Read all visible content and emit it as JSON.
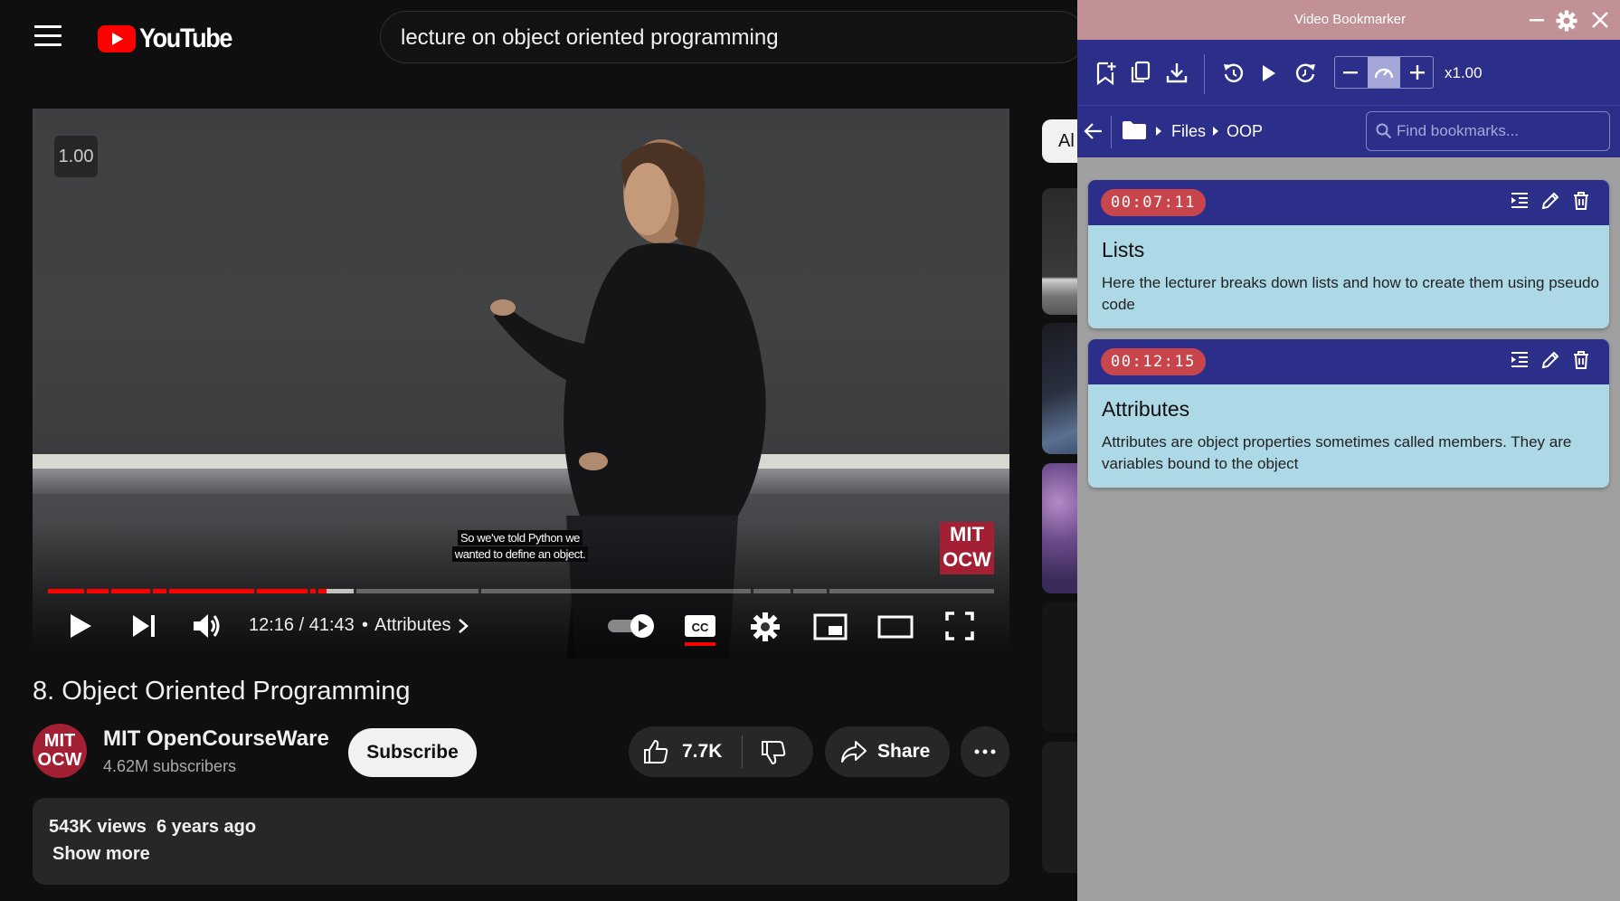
{
  "youtube": {
    "logo_text": "YouTube",
    "search_query": "lecture on object oriented programming"
  },
  "player": {
    "speed_badge": "1.00",
    "caption_line1": "So we've told Python we",
    "caption_line2": "wanted to define an object.",
    "watermark_line1": "MIT",
    "watermark_line2": "OCW",
    "time_current": "12:16",
    "time_separator": " / ",
    "time_total": "41:43",
    "chapter_separator": "•",
    "chapter": "Attributes",
    "progress_fraction": 0.294,
    "progress_chapter_gaps": [
      0.038,
      0.064,
      0.108,
      0.125,
      0.218,
      0.274,
      0.283,
      0.323,
      0.455,
      0.743,
      0.785,
      0.823
    ]
  },
  "video": {
    "title": "8. Object Oriented Programming",
    "channel": "MIT OpenCourseWare",
    "subscribers": "4.62M subscribers",
    "subscribe_label": "Subscribe",
    "likes": "7.7K",
    "share_label": "Share",
    "views": "543K views",
    "age": "6 years ago",
    "show_more": "Show more",
    "avatar_line1": "MIT",
    "avatar_line2": "OCW"
  },
  "sidebar": {
    "chip_label": "Al"
  },
  "extension": {
    "title": "Video Bookmarker",
    "speed": "x1.00",
    "breadcrumb": [
      "Files",
      "OOP"
    ],
    "search_placeholder": "Find bookmarks...",
    "bookmarks": [
      {
        "time": "00:07:11",
        "title": "Lists",
        "description": "Here the lecturer breaks down lists and how to create them using pseudo code"
      },
      {
        "time": "00:12:15",
        "title": "Attributes",
        "description": "Attributes are object properties sometimes called members. They are variables bound to the object"
      }
    ]
  },
  "colors": {
    "youtube_red": "#ff0000",
    "ext_toolbar": "#2b2f8a",
    "ext_titlebar": "#c19195",
    "card_body": "#add8e6",
    "time_badge": "#c8454b"
  }
}
